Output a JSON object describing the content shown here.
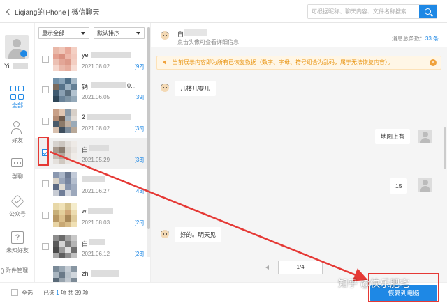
{
  "titlebar": {
    "back_label": "Liqiang的iPhone | 微信聊天",
    "search_placeholder": "可根据昵称、聊天内容、文件名称搜索"
  },
  "leftnav": {
    "username": "Yi",
    "items": [
      {
        "label": "全部",
        "icon": "grid-icon",
        "active": true
      },
      {
        "label": "好友",
        "icon": "friend-icon",
        "active": false
      },
      {
        "label": "群聊",
        "icon": "group-chat-icon",
        "active": false
      },
      {
        "label": "公众号",
        "icon": "official-account-icon",
        "active": false
      },
      {
        "label": "未知好友",
        "icon": "unknown-friend-icon",
        "active": false
      }
    ],
    "attachments_label": "附件管理"
  },
  "contacts": {
    "filter_show": "显示全部",
    "filter_sort": "默认排序",
    "rows": [
      {
        "name": "ye",
        "date": "2021.08.02",
        "count": "[92]",
        "checked": false,
        "selected": false
      },
      {
        "name": "钠",
        "name_tail": "0...",
        "date": "2021.06.05",
        "count": "[39]",
        "checked": false,
        "selected": false
      },
      {
        "name": "2",
        "date": "2021.08.02",
        "count": "[35]",
        "checked": false,
        "selected": false
      },
      {
        "name": "白",
        "date": "2021.05.29",
        "count": "[33]",
        "checked": true,
        "selected": true
      },
      {
        "name": "",
        "date": "2021.06.27",
        "count": "[43]",
        "checked": false,
        "selected": false
      },
      {
        "name": "w",
        "date": "2021.08.03",
        "count": "[25]",
        "checked": false,
        "selected": false
      },
      {
        "name": "白",
        "date": "2021.06.12",
        "count": "[23]",
        "checked": false,
        "selected": false
      },
      {
        "name": "zh",
        "date": "",
        "count": "",
        "checked": false,
        "selected": false
      }
    ]
  },
  "chat": {
    "header_name": "白",
    "header_hint": "点击头像可查看详细信息",
    "total_label": "消息总条数：",
    "total_count": "33 条",
    "notice": "当前展示内容即为所有已恢复数据（数字、字母、符号组合为乱码，属于无法恢复内容）。",
    "messages": [
      {
        "side": "left",
        "text": "几楼几零几"
      },
      {
        "side": "right",
        "text": "地图上有"
      },
      {
        "side": "right",
        "text": "15"
      },
      {
        "side": "left",
        "text": "好的。明天见"
      }
    ],
    "page": "1/4"
  },
  "footer": {
    "select_all": "全选",
    "selected_prefix": "已选",
    "selected_count": "1",
    "selected_suffix": "项  共 39 项",
    "recover_button": "恢复到电脑"
  },
  "watermark": "知乎 @快乐肥宅",
  "colors": {
    "accent": "#1e88e5",
    "annotation_red": "#e53935",
    "notice_text": "#e8920c"
  }
}
